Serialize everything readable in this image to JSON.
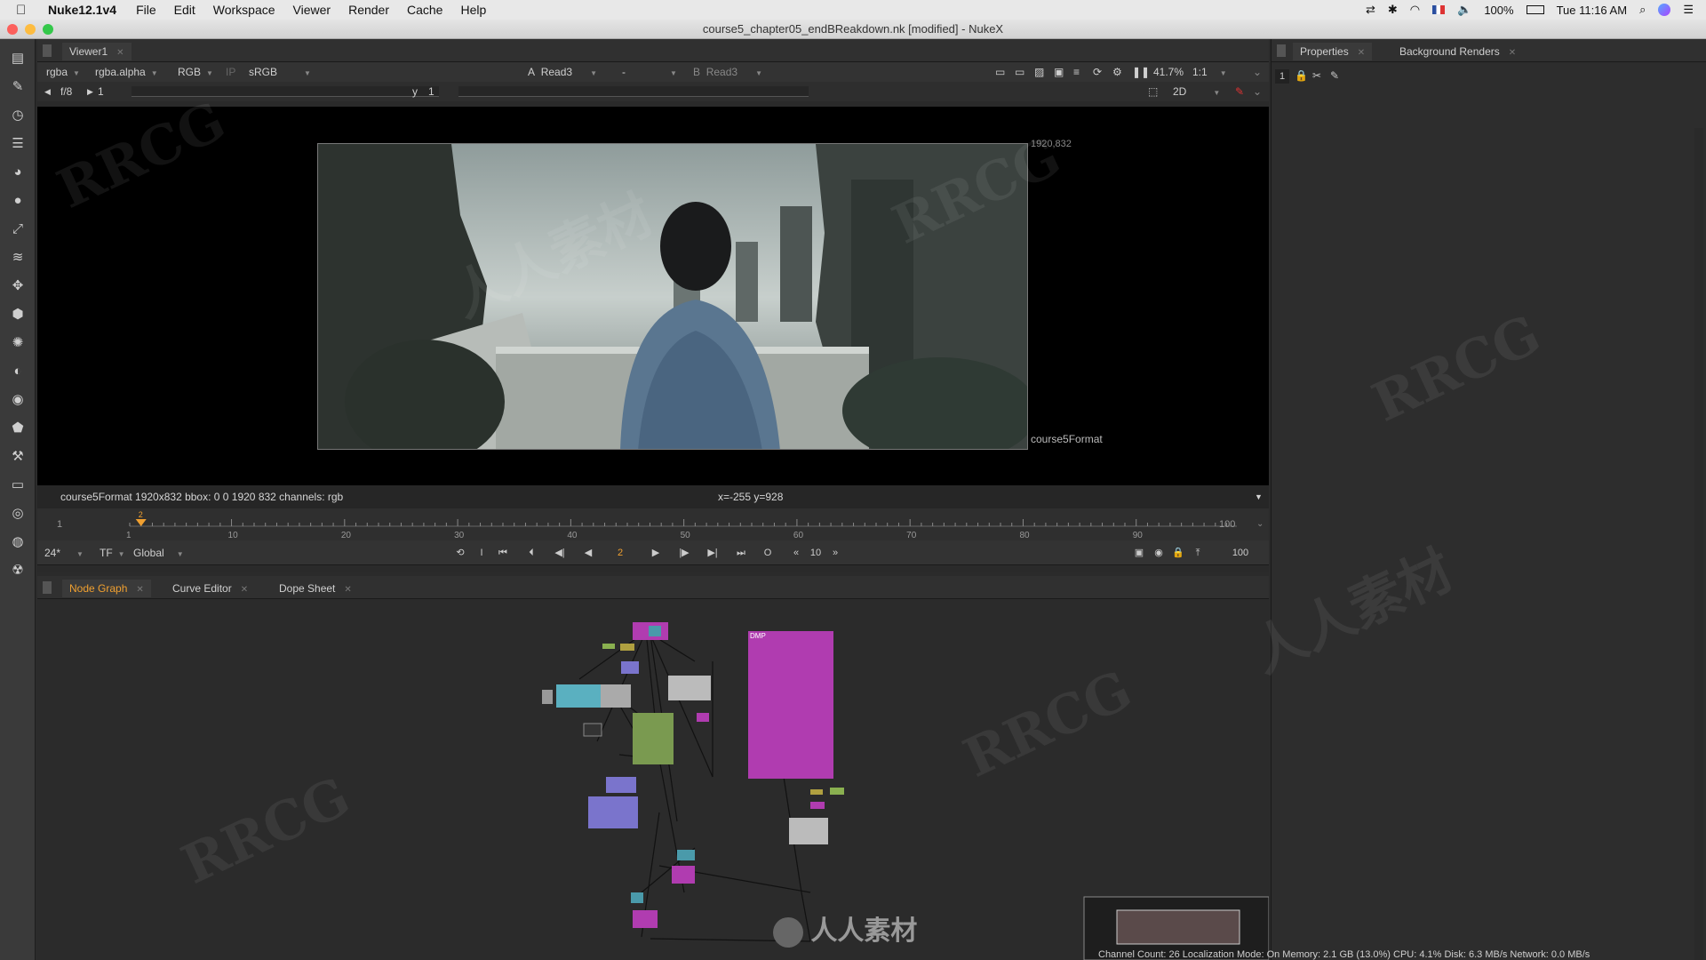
{
  "menubar": {
    "app_name": "Nuke12.1v4",
    "items": [
      "File",
      "Edit",
      "Workspace",
      "Viewer",
      "Render",
      "Cache",
      "Help"
    ],
    "battery": "100%",
    "clock": "Tue 11:16 AM"
  },
  "window": {
    "title": "course5_chapter05_endBReakdown.nk [modified] - NukeX"
  },
  "viewer": {
    "tab_label": "Viewer1",
    "channels": "rgba",
    "alpha": "rgba.alpha",
    "display_channel": "RGB",
    "ip_label": "IP",
    "colorspace": "sRGB",
    "input_a_label": "A",
    "input_a": "Read3",
    "wipe": "-",
    "input_b_label": "B",
    "input_b": "Read3",
    "zoom": "41.7%",
    "ratio": "1:1",
    "fstop": "f/8",
    "gain": "1",
    "y_label": "y",
    "gamma": "1",
    "view_mode": "2D",
    "format_size_label": "1920,832",
    "format_name_label": "course5Format",
    "info_left": "course5Format 1920x832  bbox: 0 0 1920 832 channels: rgb",
    "info_coords": "x=-255 y=928"
  },
  "timeline": {
    "start": "1",
    "end": "100",
    "ticks": [
      "1",
      "10",
      "20",
      "30",
      "40",
      "50",
      "60",
      "70",
      "80",
      "90",
      "100"
    ],
    "current_frame": "2",
    "fps": "24*",
    "tf": "TF",
    "range_mode": "Global",
    "step": "10",
    "end_frame_field": "100",
    "playhead_fraction": 0.01
  },
  "nodegraph": {
    "tabs": [
      "Node Graph",
      "Curve Editor",
      "Dope Sheet"
    ],
    "backdrop_label": "DMP"
  },
  "properties": {
    "tabs": [
      "Properties",
      "Background Renders"
    ],
    "max_panels": "1"
  },
  "status": {
    "text": "Channel Count: 26  Localization Mode: On  Memory: 2.1 GB (13.0%)  CPU: 4.1%  Disk: 6.3 MB/s  Network: 0.0 MB/s"
  },
  "watermarks": [
    "RRCG",
    "人人素材"
  ],
  "colors": {
    "accent_orange": "#f0a030",
    "node_purple": "#b03cb0",
    "node_blue": "#7a74cc",
    "node_green": "#7a9a50"
  }
}
